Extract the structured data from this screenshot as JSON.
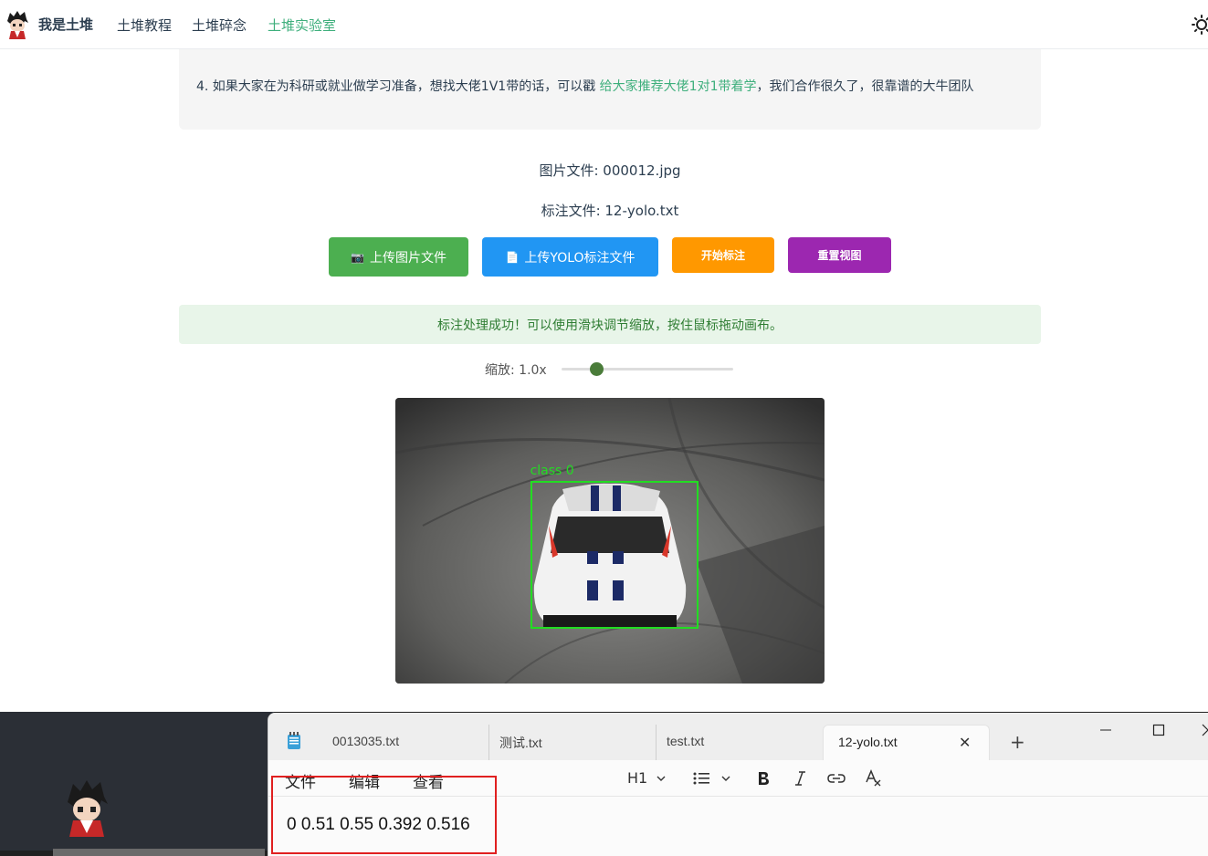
{
  "nav": {
    "brand": "我是土堆",
    "links": [
      "土堆教程",
      "土堆碎念",
      "土堆实验室"
    ],
    "active_index": 2
  },
  "notice": {
    "prev_line": "……",
    "text_before": "4. 如果大家在为科研或就业做学习准备，想找大佬1V1带的话，可以戳 ",
    "link_text": "给大家推荐大佬1对1带着学",
    "text_after": "，我们合作很久了，很靠谱的大牛团队"
  },
  "files": {
    "image_file": "图片文件: 000012.jpg",
    "label_file": "标注文件: 12-yolo.txt"
  },
  "buttons": {
    "upload_image": "上传图片文件",
    "upload_image_icon": "📷",
    "upload_yolo": "上传YOLO标注文件",
    "upload_yolo_icon": "📄",
    "start": "开始标注",
    "reset": "重置视图"
  },
  "status": {
    "message": "标注处理成功！可以使用滑块调节缩放，按住鼠标拖动画布。"
  },
  "zoom": {
    "label": "缩放: 1.0x",
    "min": 0.5,
    "max": 3.0,
    "value": 1.0
  },
  "annotation": {
    "label": "class 0",
    "class_id": 0,
    "x_center": 0.51,
    "y_center": 0.55,
    "width": 0.392,
    "height": 0.516
  },
  "notepad": {
    "tabs": [
      "0013035.txt",
      "测试.txt",
      "test.txt",
      "12-yolo.txt"
    ],
    "active_tab": 3,
    "close_glyph": "✕",
    "add_glyph": "+",
    "menus": [
      "文件",
      "编辑",
      "查看"
    ],
    "heading_select": "H1",
    "content": "0 0.51 0.55 0.392 0.516"
  },
  "colors": {
    "accent": "#3eaf7c",
    "bbox": "#22dd22",
    "btn_green": "#4caf50",
    "btn_blue": "#2196f3",
    "btn_orange": "#ff9800",
    "btn_purple": "#9c27b0",
    "highlight": "#e02020"
  }
}
